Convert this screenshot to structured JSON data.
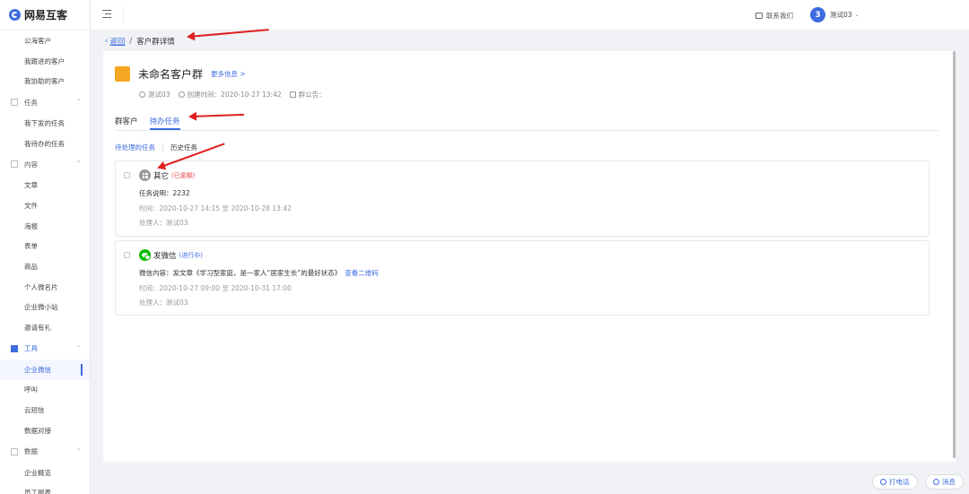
{
  "app": {
    "name": "网易互客"
  },
  "sidebar": {
    "items": [
      {
        "type": "item",
        "label": "公海客户"
      },
      {
        "type": "item",
        "label": "我跟进的客户"
      },
      {
        "type": "item",
        "label": "我协助的客户"
      },
      {
        "type": "group",
        "label": "任务"
      },
      {
        "type": "item",
        "label": "我下发的任务"
      },
      {
        "type": "item",
        "label": "我待办的任务"
      },
      {
        "type": "group",
        "label": "内容"
      },
      {
        "type": "item",
        "label": "文章"
      },
      {
        "type": "item",
        "label": "文件"
      },
      {
        "type": "item",
        "label": "海报"
      },
      {
        "type": "item",
        "label": "表单"
      },
      {
        "type": "item",
        "label": "商品"
      },
      {
        "type": "item",
        "label": "个人微名片"
      },
      {
        "type": "item",
        "label": "企业微小站"
      },
      {
        "type": "item",
        "label": "邀请有礼"
      },
      {
        "type": "group",
        "label": "工具"
      },
      {
        "type": "item",
        "label": "企业微信"
      },
      {
        "type": "item",
        "label": "呼叫"
      },
      {
        "type": "item",
        "label": "云短信"
      },
      {
        "type": "item",
        "label": "数据对接"
      },
      {
        "type": "group",
        "label": "数据"
      },
      {
        "type": "item",
        "label": "企业概览"
      },
      {
        "type": "item",
        "label": "员工报表"
      }
    ]
  },
  "topbar": {
    "contact": "联系我们",
    "avatar_initial": "3",
    "user_name": "测试03"
  },
  "breadcrumb": {
    "back": "返回",
    "sep": "/",
    "current": "客户群详情"
  },
  "group": {
    "title": "未命名客户群",
    "more_info": "更多信息 >",
    "owner": "测试03",
    "created": "创建时间：2020-10-27 13:42",
    "notice": "群公告："
  },
  "tabs": [
    "群客户",
    "待办任务"
  ],
  "subtabs": [
    "待处理的任务",
    "历史任务"
  ],
  "tasks": [
    {
      "title": "其它",
      "status": "(已逾期)",
      "line1": "任务说明：2232",
      "time": "时间：2020-10-27 14:15 至 2020-10-28 13:42",
      "handler": "处理人：测试03"
    },
    {
      "title": "发微信",
      "status": "(进行中)",
      "line1": "微信内容：发文章《学习型家庭，是一家人“居家生长”的最好状态》",
      "link": "查看二维码",
      "time": "时间：2020-10-27 09:00 至 2020-10-31 17:00",
      "handler": "处理人：测试03"
    }
  ],
  "float_buttons": {
    "call": "打电话",
    "message": "消息"
  },
  "colors": {
    "accent": "#3d6be0",
    "group_avatar": "#f5a623",
    "overdue": "#e84b4b",
    "wechat": "#09bb07",
    "annotation": "#e02020"
  }
}
